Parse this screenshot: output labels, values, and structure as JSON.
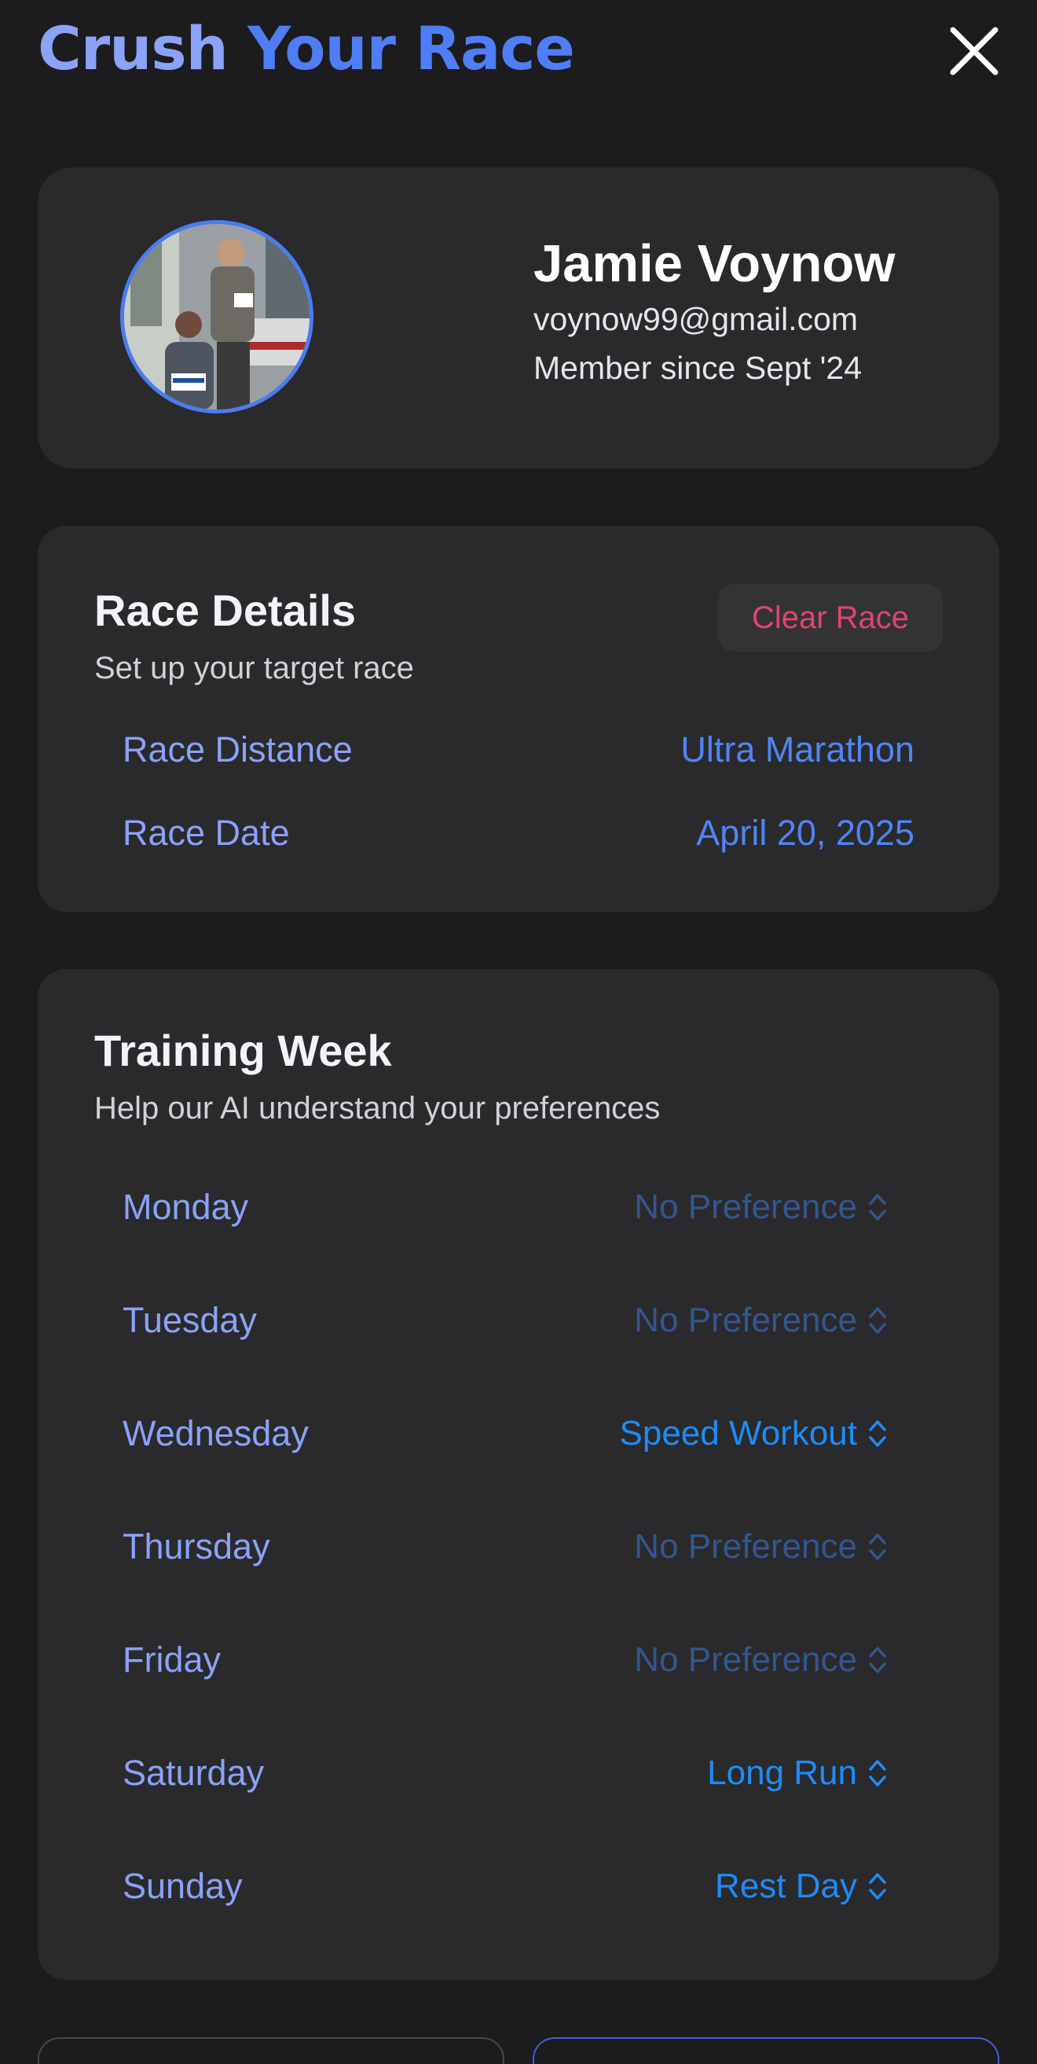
{
  "header": {
    "title_part1": "Crush",
    "title_part2": "Your Race",
    "close_icon": "close-icon"
  },
  "profile": {
    "name": "Jamie Voynow",
    "email": "voynow99@gmail.com",
    "member_since": "Member since Sept '24",
    "avatar_icon": "avatar-photo"
  },
  "race_details": {
    "title": "Race Details",
    "subtitle": "Set up your target race",
    "clear_label": "Clear Race",
    "rows": [
      {
        "label": "Race Distance",
        "value": "Ultra Marathon"
      },
      {
        "label": "Race Date",
        "value": "April 20, 2025"
      }
    ]
  },
  "training_week": {
    "title": "Training Week",
    "subtitle": "Help our AI understand your preferences",
    "days": [
      {
        "day": "Monday",
        "preference": "No Preference",
        "set": false
      },
      {
        "day": "Tuesday",
        "preference": "No Preference",
        "set": false
      },
      {
        "day": "Wednesday",
        "preference": "Speed Workout",
        "set": true
      },
      {
        "day": "Thursday",
        "preference": "No Preference",
        "set": false
      },
      {
        "day": "Friday",
        "preference": "No Preference",
        "set": false
      },
      {
        "day": "Saturday",
        "preference": "Long Run",
        "set": true
      },
      {
        "day": "Sunday",
        "preference": "Rest Day",
        "set": true
      }
    ]
  },
  "colors": {
    "background": "#1c1c1e",
    "card": "#2a2a2c",
    "title_light_blue": "#8aa2f7",
    "title_blue": "#4f7df6",
    "active_picker": "#1e8cf5",
    "muted_picker": "#33568f",
    "clear_race_red": "#e0456c"
  }
}
